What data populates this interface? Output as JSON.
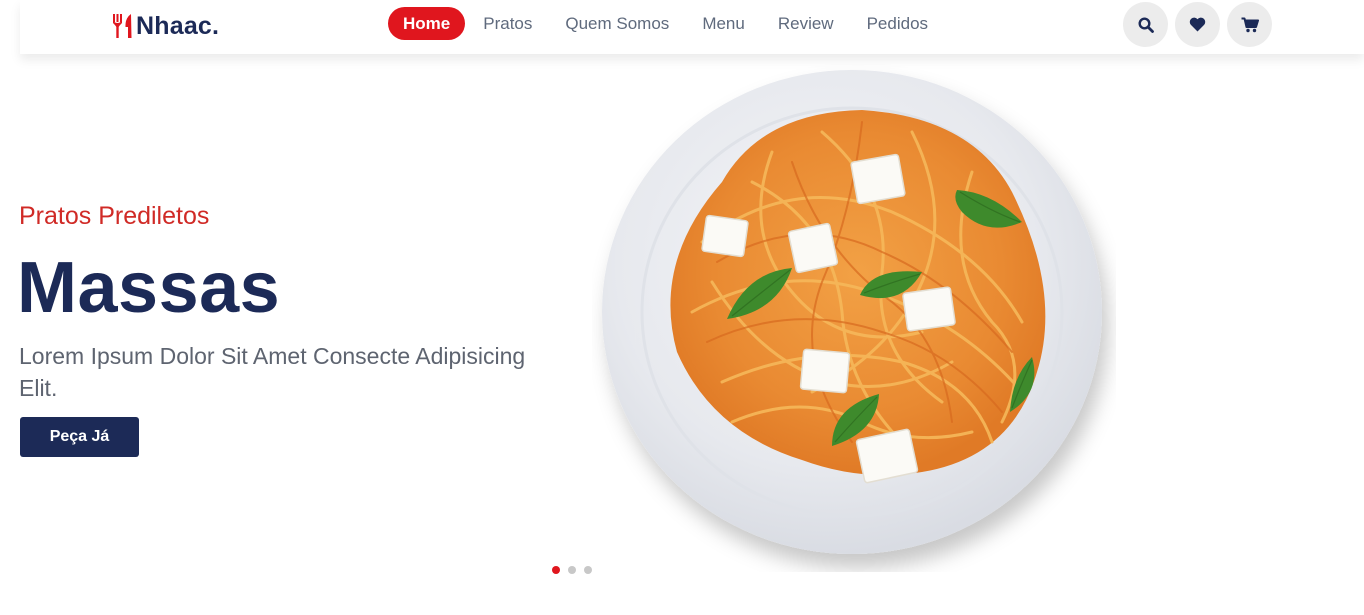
{
  "brand": {
    "name": "Nhaac.",
    "logo_icon": "fork-knife-icon"
  },
  "nav": {
    "items": [
      {
        "label": "Home",
        "active": true
      },
      {
        "label": "Pratos",
        "active": false
      },
      {
        "label": "Quem Somos",
        "active": false
      },
      {
        "label": "Menu",
        "active": false
      },
      {
        "label": "Review",
        "active": false
      },
      {
        "label": "Pedidos",
        "active": false
      }
    ]
  },
  "actions": [
    {
      "icon": "search-icon"
    },
    {
      "icon": "heart-icon"
    },
    {
      "icon": "cart-icon"
    }
  ],
  "hero": {
    "subtitle": "Pratos Prediletos",
    "title": "Massas",
    "description": "Lorem Ipsum Dolor Sit Amet Consecte Adipisicing Elit.",
    "cta_label": "Peça Já",
    "image": "spaghetti-plate-image"
  },
  "carousel": {
    "slides": 3,
    "active_index": 0
  },
  "colors": {
    "accent_red": "#e0161e",
    "navy": "#1c2a57",
    "subtitle_red": "#d02a26",
    "text_gray": "#5e6470"
  }
}
